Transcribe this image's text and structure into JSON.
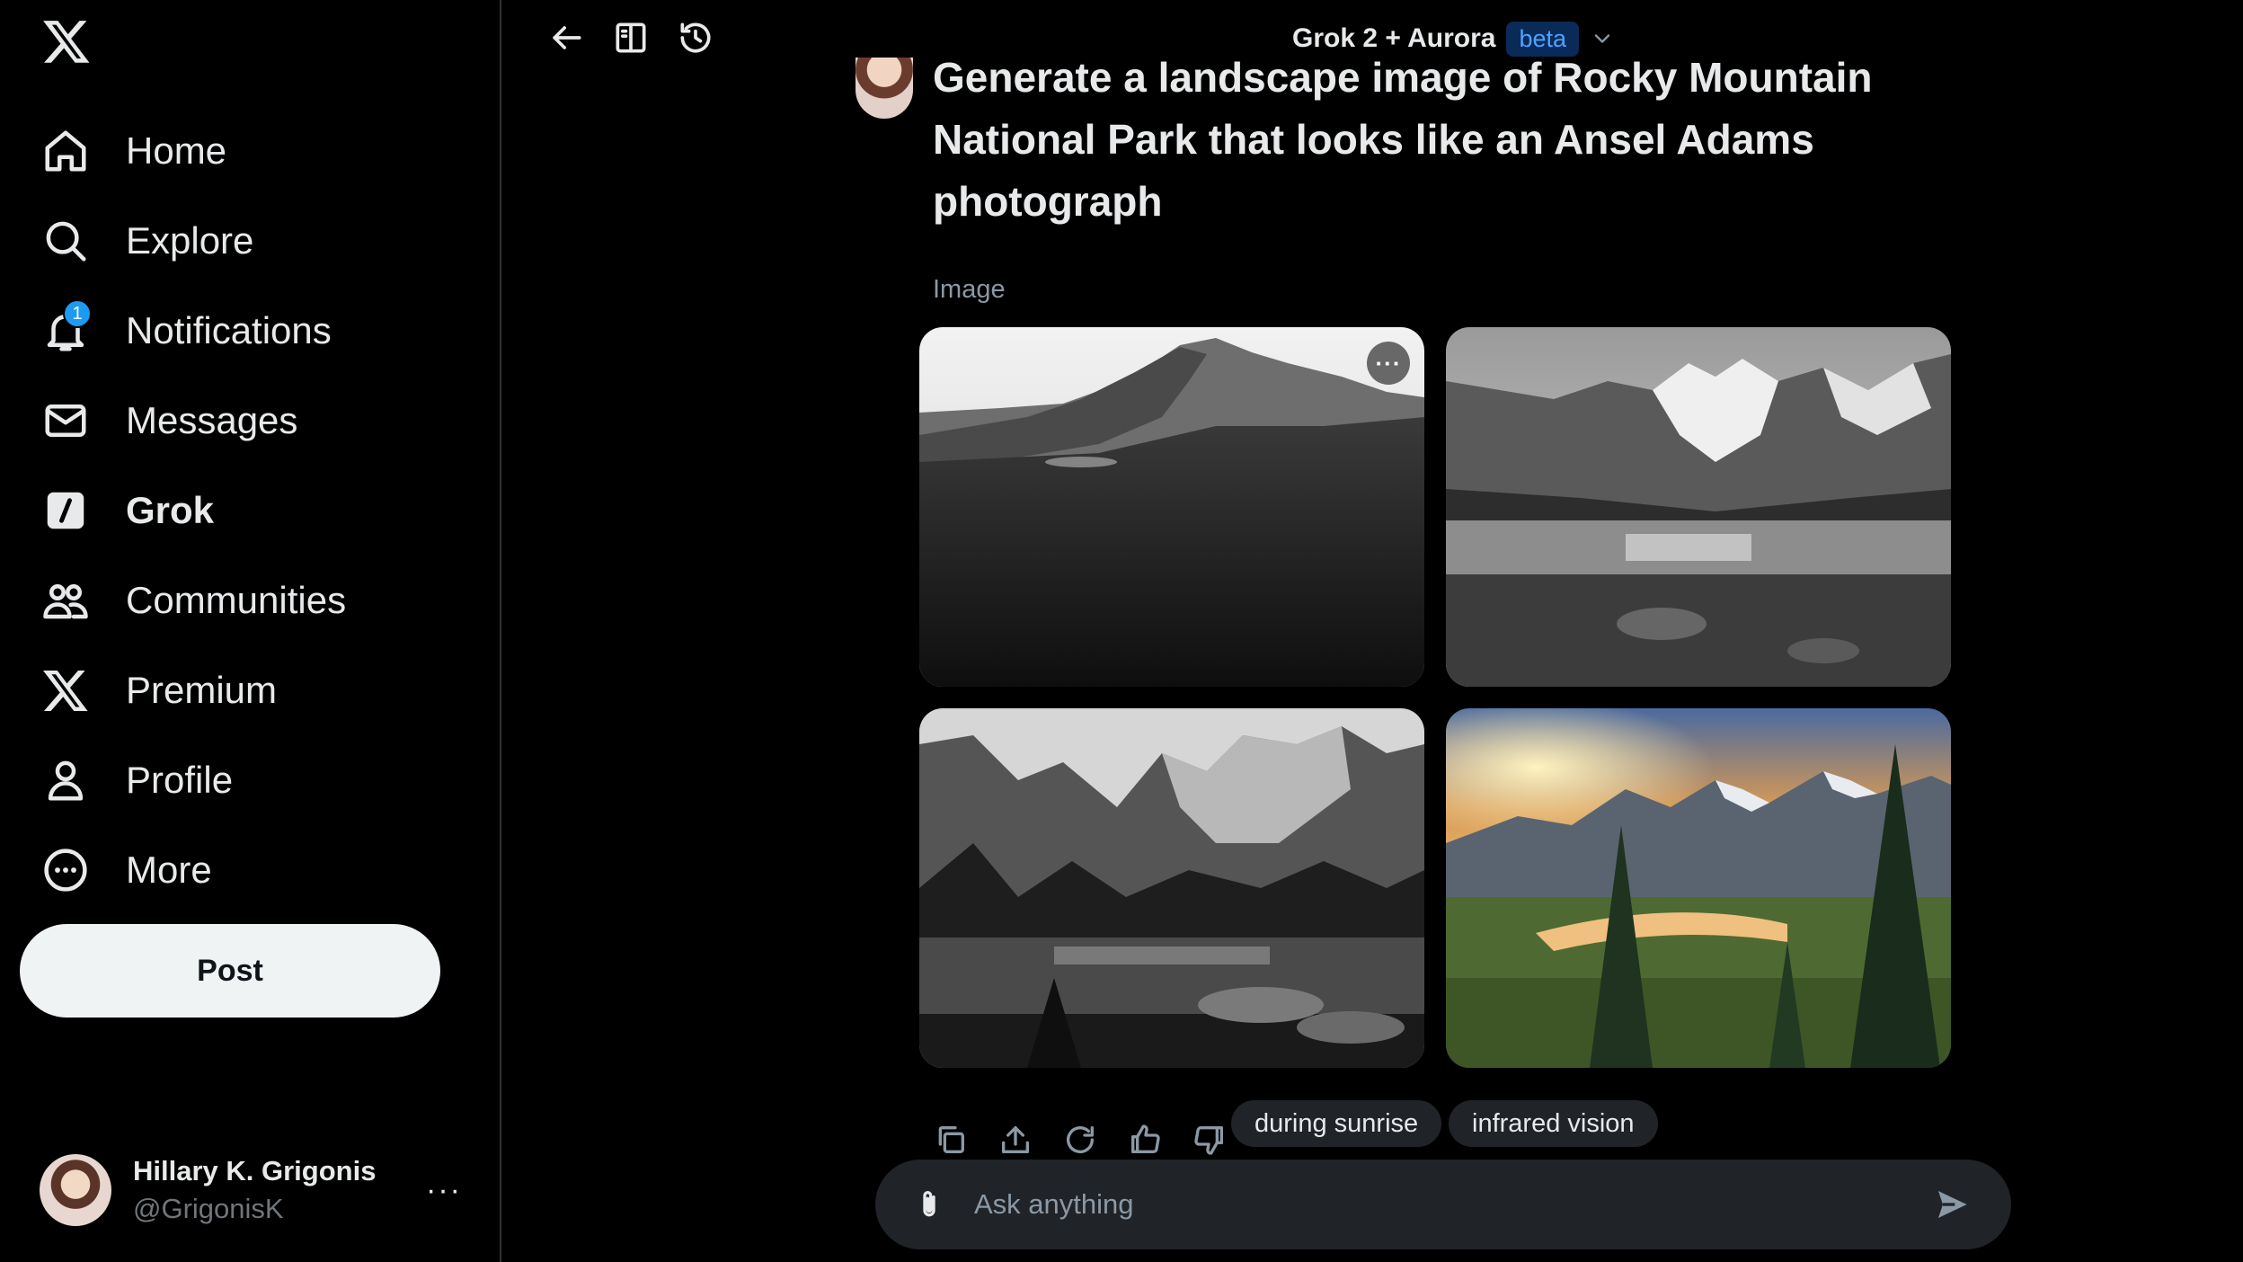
{
  "sidebar": {
    "items": [
      {
        "label": "Home",
        "icon": "home-icon"
      },
      {
        "label": "Explore",
        "icon": "search-icon"
      },
      {
        "label": "Notifications",
        "icon": "bell-icon",
        "badge": "1"
      },
      {
        "label": "Messages",
        "icon": "envelope-icon"
      },
      {
        "label": "Grok",
        "icon": "grok-icon",
        "active": true
      },
      {
        "label": "Communities",
        "icon": "people-icon"
      },
      {
        "label": "Premium",
        "icon": "x-logo-icon"
      },
      {
        "label": "Profile",
        "icon": "person-icon"
      },
      {
        "label": "More",
        "icon": "more-circle-icon"
      }
    ],
    "post_label": "Post",
    "account": {
      "name": "Hillary K. Grigonis",
      "handle": "@GrigonisK",
      "more": "···"
    }
  },
  "header": {
    "model_name": "Grok 2 + Aurora",
    "badge": "beta"
  },
  "conversation": {
    "prompt": "Generate a landscape image of Rocky Mountain National Park that looks like an Ansel Adams photograph",
    "section_label": "Image",
    "images": [
      {
        "description": "black and white mountain peak",
        "more": "···"
      },
      {
        "description": "black and white alpine lake with snowy peaks"
      },
      {
        "description": "black and white lake with jagged peaks and pines"
      },
      {
        "description": "color sunset valley with pines and river"
      }
    ],
    "suggestions": [
      "during sunrise",
      "infrared vision"
    ]
  },
  "composer": {
    "placeholder": "Ask anything"
  },
  "colors": {
    "background": "#000000",
    "accent": "#1d9bf0",
    "beta_bg": "#0a2a58",
    "beta_text": "#4da3ff",
    "chip_bg": "#202327"
  }
}
